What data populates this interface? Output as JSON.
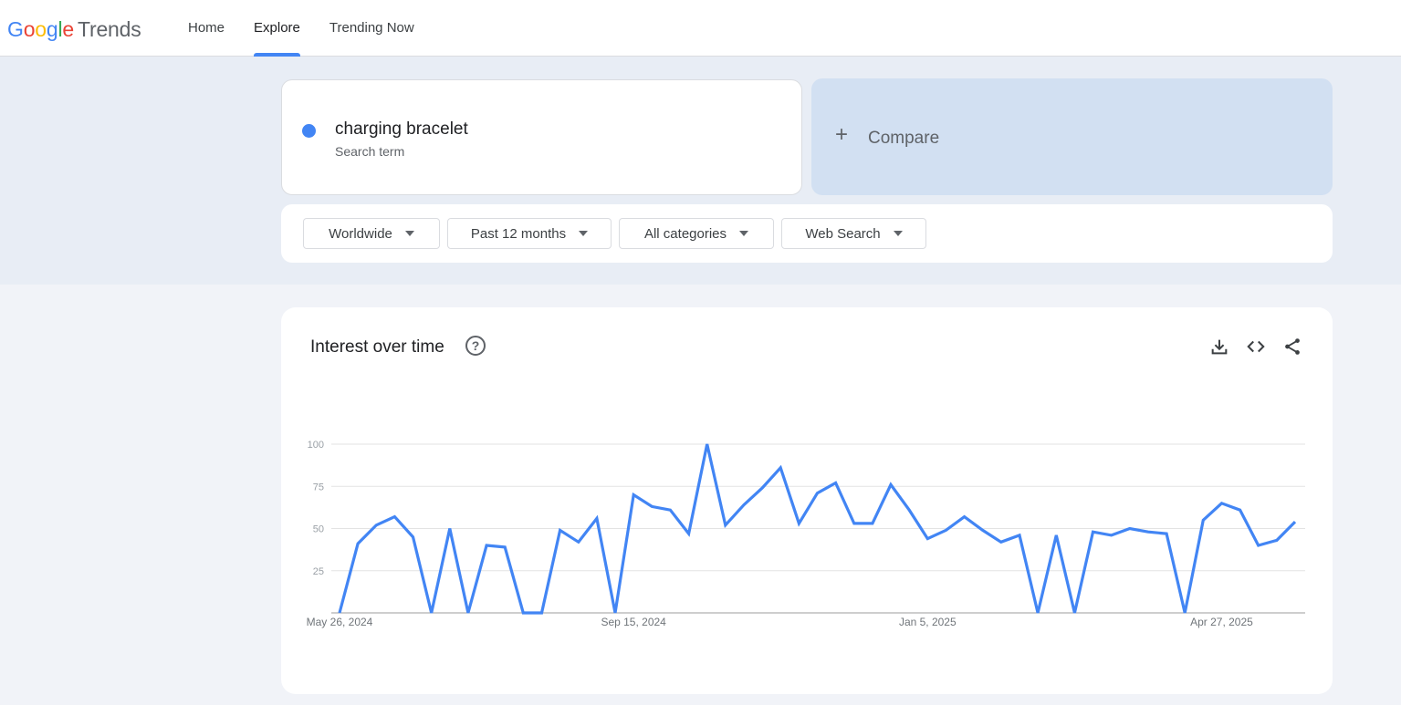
{
  "header": {
    "logo_google": [
      "G",
      "o",
      "o",
      "g",
      "l",
      "e"
    ],
    "logo_product": "Trends",
    "nav": [
      {
        "label": "Home",
        "active": false
      },
      {
        "label": "Explore",
        "active": true
      },
      {
        "label": "Trending Now",
        "active": false
      }
    ]
  },
  "search": {
    "term": "charging bracelet",
    "term_type": "Search term",
    "term_color": "#4285f4",
    "compare_label": "Compare"
  },
  "filters": {
    "region": "Worldwide",
    "time_range": "Past 12 months",
    "category": "All categories",
    "search_type": "Web Search"
  },
  "chart_card": {
    "title": "Interest over time",
    "icons": [
      "help-icon",
      "download-icon",
      "embed-icon",
      "share-icon"
    ]
  },
  "chart_data": {
    "type": "line",
    "title": "Interest over time",
    "xlabel": "",
    "ylabel": "",
    "ylim": [
      0,
      100
    ],
    "y_ticks": [
      25,
      50,
      75,
      100
    ],
    "x_tick_labels": [
      "May 26, 2024",
      "Sep 15, 2024",
      "Jan 5, 2025",
      "Apr 27, 2025"
    ],
    "x_tick_indices": [
      0,
      16,
      32,
      48
    ],
    "grid": true,
    "series": [
      {
        "name": "charging bracelet",
        "color": "#4285f4",
        "values": [
          0,
          41,
          52,
          57,
          45,
          0,
          50,
          0,
          40,
          39,
          0,
          0,
          49,
          42,
          56,
          0,
          70,
          63,
          61,
          47,
          100,
          52,
          64,
          74,
          86,
          53,
          71,
          77,
          53,
          53,
          76,
          61,
          44,
          49,
          57,
          49,
          42,
          46,
          0,
          46,
          0,
          48,
          46,
          50,
          48,
          47,
          0,
          55,
          65,
          61,
          40,
          43,
          54
        ]
      }
    ]
  }
}
